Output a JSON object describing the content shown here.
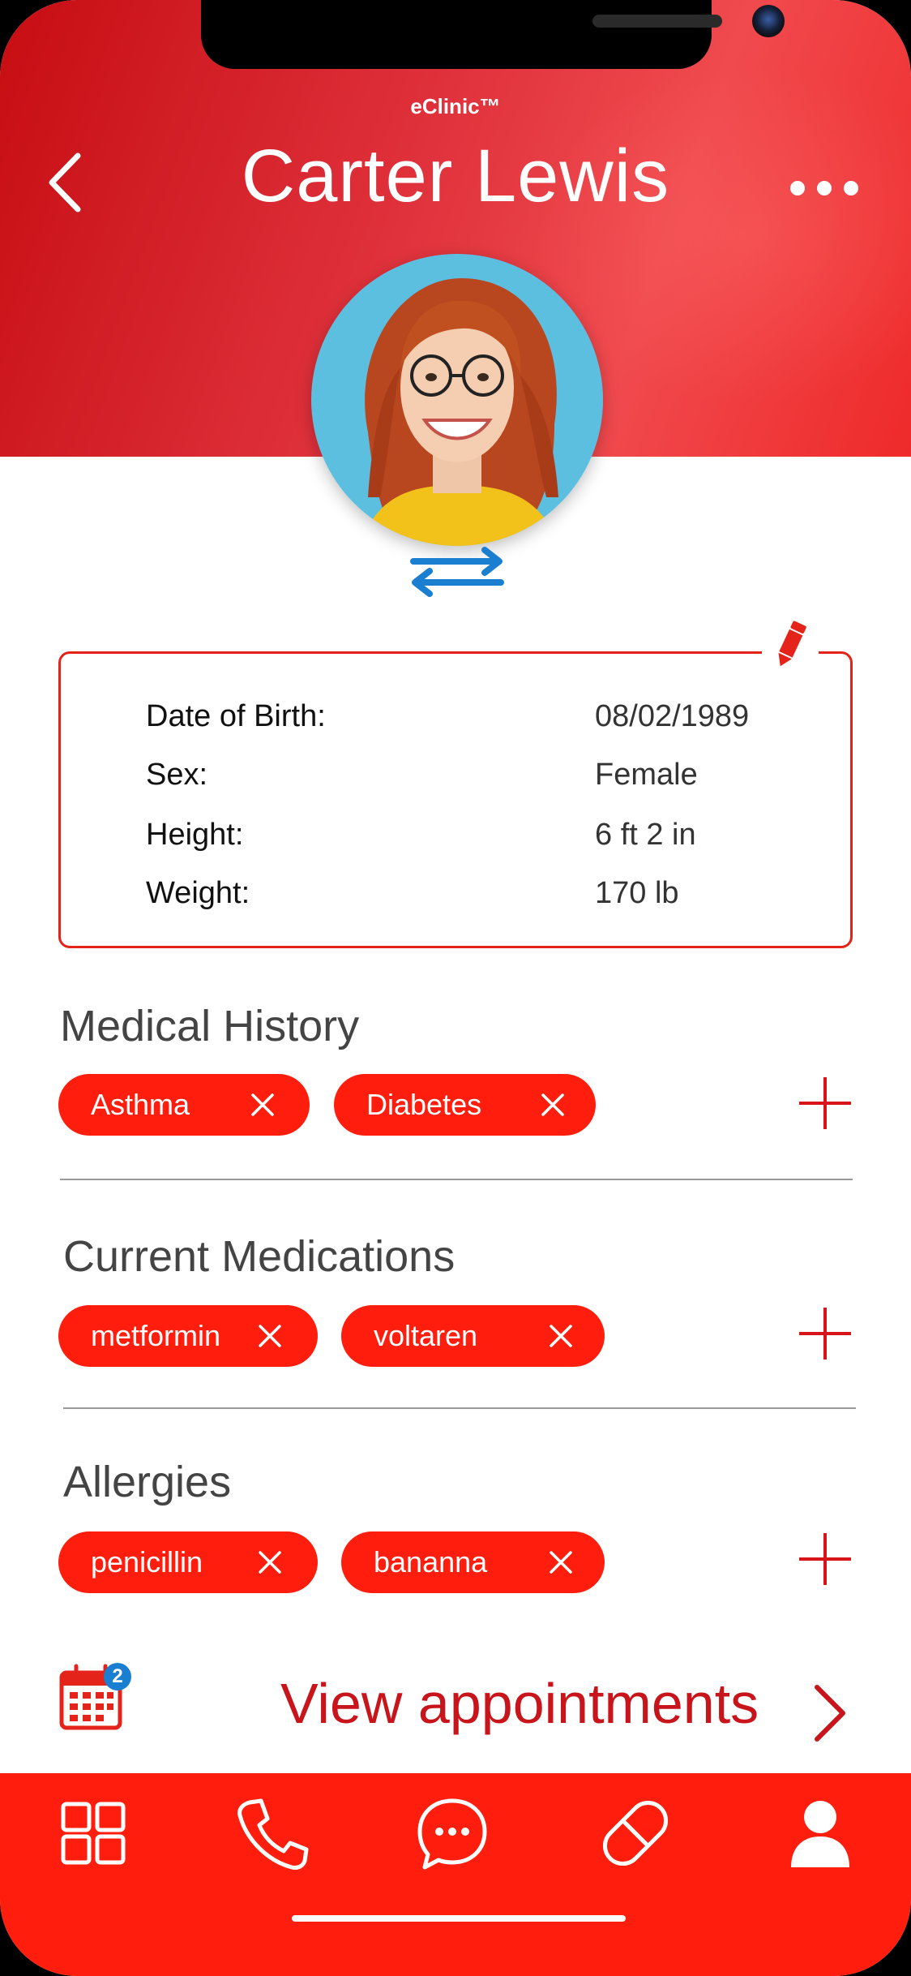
{
  "app": {
    "brand": "eClinic™"
  },
  "header": {
    "patient_name": "Carter Lewis"
  },
  "info": [
    {
      "label": "Date of Birth:",
      "value": "08/02/1989"
    },
    {
      "label": "Sex:",
      "value": "Female"
    },
    {
      "label": "Height:",
      "value": "6 ft 2 in"
    },
    {
      "label": "Weight:",
      "value": "170 lb"
    }
  ],
  "medical_history": {
    "title": "Medical History",
    "items": [
      "Asthma",
      "Diabetes"
    ]
  },
  "medications": {
    "title": "Current Medications",
    "items": [
      "metformin",
      "voltaren"
    ]
  },
  "allergies": {
    "title": "Allergies",
    "items": [
      "penicillin",
      "bananna"
    ]
  },
  "appointments": {
    "label": "View appointments",
    "badge_count": "2"
  },
  "colors": {
    "accent": "#ff1e0e",
    "dark_red": "#c8141b",
    "swap_blue": "#1a7fd0"
  },
  "icons": {
    "back": "chevron-left-icon",
    "more": "more-horizontal-icon",
    "swap": "swap-arrows-icon",
    "edit": "pencil-icon",
    "remove": "close-icon",
    "add": "plus-icon",
    "calendar": "calendar-icon",
    "tabs": [
      "dashboard-icon",
      "phone-icon",
      "chat-icon",
      "pill-icon",
      "profile-icon"
    ]
  }
}
